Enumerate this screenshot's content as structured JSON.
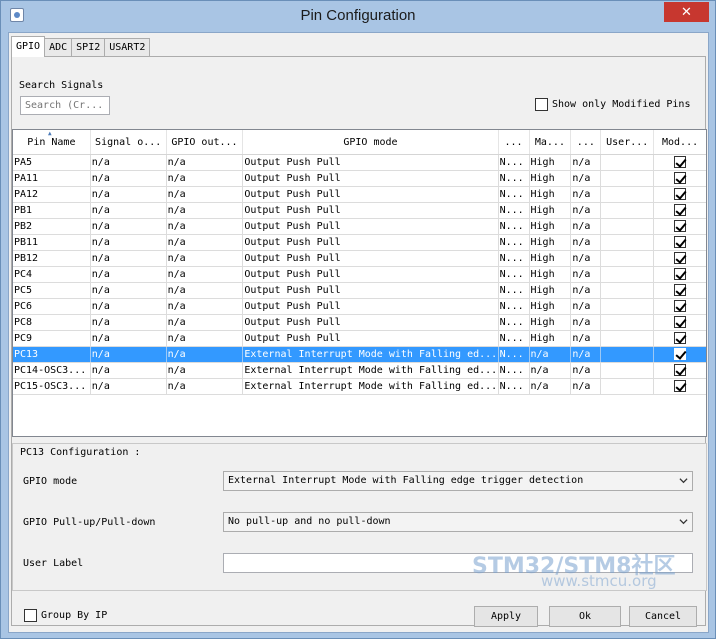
{
  "window": {
    "title": "Pin Configuration",
    "close_glyph": "✕"
  },
  "tabs": [
    "GPIO",
    "ADC",
    "SPI2",
    "USART2"
  ],
  "search": {
    "label": "Search Signals",
    "placeholder": "Search (Cr..."
  },
  "show_modified": {
    "label": "Show only Modified Pins",
    "checked": false
  },
  "table": {
    "headers": [
      "Pin Name",
      "Signal o...",
      "GPIO out...",
      "GPIO mode",
      "...",
      "Ma...",
      "...",
      "User...",
      "Mod..."
    ],
    "rows": [
      [
        "PA5",
        "n/a",
        "n/a",
        "Output Push Pull",
        "N...",
        "High",
        "n/a",
        ""
      ],
      [
        "PA11",
        "n/a",
        "n/a",
        "Output Push Pull",
        "N...",
        "High",
        "n/a",
        ""
      ],
      [
        "PA12",
        "n/a",
        "n/a",
        "Output Push Pull",
        "N...",
        "High",
        "n/a",
        ""
      ],
      [
        "PB1",
        "n/a",
        "n/a",
        "Output Push Pull",
        "N...",
        "High",
        "n/a",
        ""
      ],
      [
        "PB2",
        "n/a",
        "n/a",
        "Output Push Pull",
        "N...",
        "High",
        "n/a",
        ""
      ],
      [
        "PB11",
        "n/a",
        "n/a",
        "Output Push Pull",
        "N...",
        "High",
        "n/a",
        ""
      ],
      [
        "PB12",
        "n/a",
        "n/a",
        "Output Push Pull",
        "N...",
        "High",
        "n/a",
        ""
      ],
      [
        "PC4",
        "n/a",
        "n/a",
        "Output Push Pull",
        "N...",
        "High",
        "n/a",
        ""
      ],
      [
        "PC5",
        "n/a",
        "n/a",
        "Output Push Pull",
        "N...",
        "High",
        "n/a",
        ""
      ],
      [
        "PC6",
        "n/a",
        "n/a",
        "Output Push Pull",
        "N...",
        "High",
        "n/a",
        ""
      ],
      [
        "PC8",
        "n/a",
        "n/a",
        "Output Push Pull",
        "N...",
        "High",
        "n/a",
        ""
      ],
      [
        "PC9",
        "n/a",
        "n/a",
        "Output Push Pull",
        "N...",
        "High",
        "n/a",
        ""
      ],
      [
        "PC13",
        "n/a",
        "n/a",
        "External Interrupt Mode with Falling ed...",
        "N...",
        "n/a",
        "n/a",
        ""
      ],
      [
        "PC14-OSC3...",
        "n/a",
        "n/a",
        "External Interrupt Mode with Falling ed...",
        "N...",
        "n/a",
        "n/a",
        ""
      ],
      [
        "PC15-OSC3...",
        "n/a",
        "n/a",
        "External Interrupt Mode with Falling ed...",
        "N...",
        "n/a",
        "n/a",
        ""
      ]
    ],
    "selected_index": 12
  },
  "config": {
    "title": "PC13 Configuration :",
    "gpio_mode_label": "GPIO mode",
    "gpio_mode_value": "External Interrupt Mode with Falling edge trigger detection",
    "pull_label": "GPIO Pull-up/Pull-down",
    "pull_value": "No pull-up and no pull-down",
    "user_label": "User Label",
    "user_label_value": ""
  },
  "group_by_ip": {
    "label": "Group By IP",
    "checked": false
  },
  "buttons": {
    "apply": "Apply",
    "ok": "Ok",
    "cancel": "Cancel"
  },
  "watermark": {
    "main": "STM32/STM8社区",
    "sub": "www.stmcu.org"
  }
}
